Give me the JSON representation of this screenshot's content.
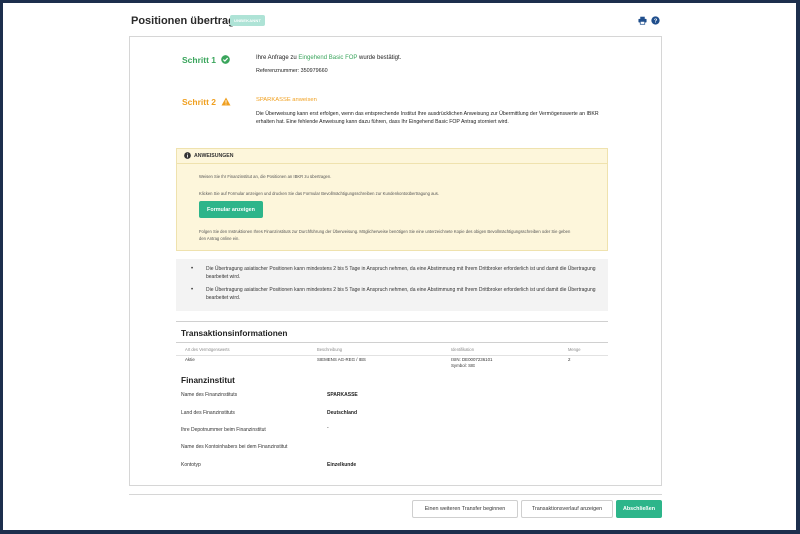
{
  "header": {
    "title": "Positionen übertragen",
    "badge": "UNBEKANNT"
  },
  "icons": {
    "print": "print-icon",
    "help": "help-icon",
    "step1": "check-circle-icon",
    "step2": "warning-triangle-icon",
    "info": "info-icon"
  },
  "colors": {
    "accent": "#2db58a",
    "success": "#3aa55c",
    "warning": "#f0a020",
    "frame": "#1d2f4d"
  },
  "step1": {
    "label": "Schritt 1",
    "text_before": "Ihre Anfrage zu ",
    "highlight": "Eingehend Basic FOP",
    "text_after": " wurde bestätigt.",
    "reference": "Referenznummer: 350979660"
  },
  "step2": {
    "label": "Schritt 2",
    "heading": "SPARKASSE anweisen",
    "body": "Die Überweisung kann erst erfolgen, wenn das entsprechende Institut Ihre ausdrücklichen Anweisung zur Übermittlung der Vermögenswerte an IBKR erhalten hat. Eine fehlende Anweisung kann dazu führen, dass Ihr Eingehend Basic FOP Antrag storniert wird."
  },
  "instructions": {
    "heading": "ANWEISUNGEN",
    "line1": "Weisen Sie Ihr Finanzinstitut an, die Positionen an IBKR zu übertragen.",
    "line2": "Klicken Sie auf Formular anzeigen und drucken Sie das Formular Bevollmächtigungsschreiben zur Kundenkontoübertragung aus.",
    "button": "Formular anzeigen",
    "line3": "Folgen Sie den Instruktionen Ihres Finanzinstituts zur Durchführung der Überweisung. Möglicherweise benötigen Sie eine unterzeichnete Kopie des obigen Bevollmächtigungsschreiben oder Sie geben den Antrag online ein."
  },
  "notes": [
    "Die Übertragung asiatischer Positionen kann mindestens 2 bis 5 Tage in Anspruch nehmen, da eine Abstimmung mit Ihrem Drittbroker erforderlich ist und damit die Übertragung bearbeitet wird.",
    "Die Übertragung asiatischer Positionen kann mindestens 2 bis 5 Tage in Anspruch nehmen, da eine Abstimmung mit Ihrem Drittbroker erforderlich ist und damit die Übertragung bearbeitet wird."
  ],
  "transactions": {
    "title": "Transaktionsinformationen",
    "columns": [
      "Art des Vermögenswerts",
      "Beschreibung",
      "Identifikation",
      "Menge"
    ],
    "rows": [
      {
        "type": "Aktie",
        "description": "SIEMENS AG-REG / IBS",
        "isin": "ISIN: DE0007236101",
        "symbol": "Symbol: SIE",
        "quantity": "2"
      }
    ]
  },
  "institution": {
    "title": "Finanzinstitut",
    "fields": [
      {
        "label": "Name des Finanzinstituts",
        "value": "SPARKASSE"
      },
      {
        "label": "Land des Finanzinstituts",
        "value": "Deutschland"
      },
      {
        "label": "Ihre Depotnummer beim Finanzinstitut",
        "value": "-"
      },
      {
        "label": "Name des Kontoinhabers bei dem Finanzinstitut",
        "value": ""
      },
      {
        "label": "Kontotyp",
        "value": "Einzelkunde"
      }
    ]
  },
  "footer": {
    "another_transfer": "Einen weiteren Transfer beginnen",
    "history": "Transaktionsverlauf anzeigen",
    "finish": "Abschließen"
  }
}
